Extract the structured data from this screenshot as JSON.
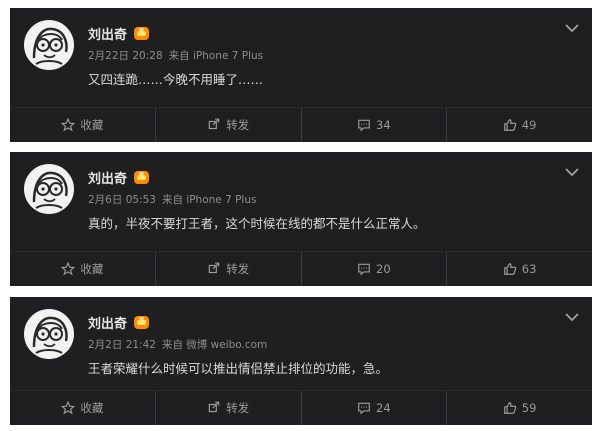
{
  "posts": [
    {
      "author": "刘出奇",
      "date": "2月22日 20:28",
      "source": "来自 iPhone 7 Plus",
      "text": "又四连跪……今晚不用睡了……",
      "actions": {
        "collect": "收藏",
        "repost": "转发",
        "comments": "34",
        "likes": "49"
      }
    },
    {
      "author": "刘出奇",
      "date": "2月6日 05:53",
      "source": "来自 iPhone 7 Plus",
      "text": "真的，半夜不要打王者，这个时候在线的都不是什么正常人。",
      "actions": {
        "collect": "收藏",
        "repost": "转发",
        "comments": "20",
        "likes": "63"
      }
    },
    {
      "author": "刘出奇",
      "date": "2月2日 21:42",
      "source": "来自 微博 weibo.com",
      "text": "王者荣耀什么时候可以推出情侣禁止排位的功能，急。",
      "actions": {
        "collect": "收藏",
        "repost": "转发",
        "comments": "24",
        "likes": "59"
      }
    }
  ],
  "colors": {
    "card_bg": "#1f1f21",
    "text": "#d9d9d9",
    "meta": "#8d8d8d",
    "badge": "#ff8a00"
  },
  "icons": [
    "avatar-glasses-cartoon",
    "vip-badge-icon",
    "chevron-down-icon",
    "star-icon",
    "repost-icon",
    "comment-icon",
    "thumbs-up-icon"
  ]
}
